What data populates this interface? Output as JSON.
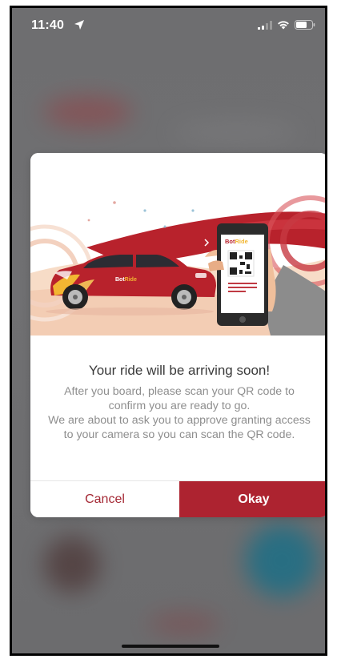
{
  "status_bar": {
    "time": "11:40",
    "location_icon": "location-arrow-icon",
    "signal_icon": "cellular-signal-icon",
    "wifi_icon": "wifi-icon",
    "battery_icon": "battery-icon"
  },
  "dialog": {
    "illustration": {
      "car_brand": "BotRide",
      "phone_brand": "BotRide",
      "brand_parts": [
        "Bot",
        "Ride"
      ]
    },
    "title": "Your ride will be arriving soon!",
    "body_line_1": "After you board, please scan your QR code to confirm you are ready to go.",
    "body_line_2": "We are about to ask you to approve granting access to your camera so you can scan the QR code.",
    "cancel_label": "Cancel",
    "okay_label": "Okay"
  },
  "colors": {
    "brand_red": "#ad2330",
    "cancel_text": "#a42834",
    "title_text": "#3a3a3a",
    "body_text": "#8e8e8e",
    "backdrop": "#6f6f70"
  }
}
